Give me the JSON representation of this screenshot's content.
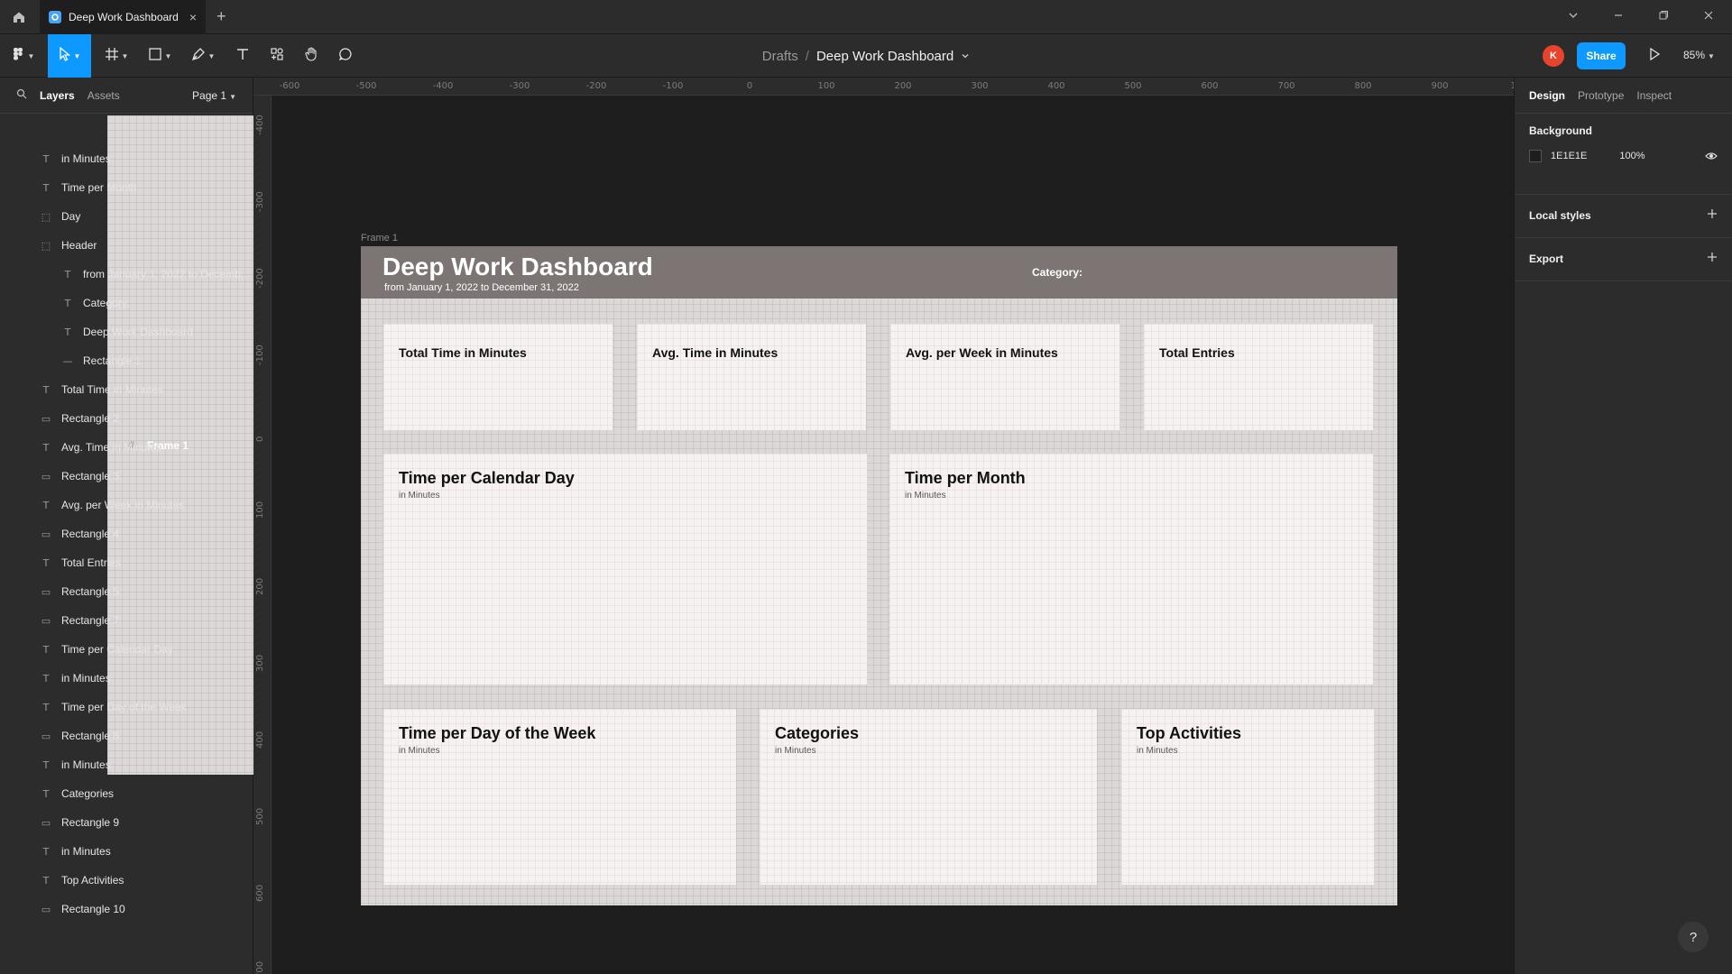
{
  "tab": {
    "title": "Deep Work Dashboard",
    "close": "×",
    "add": "+"
  },
  "breadcrumb": {
    "parent": "Drafts",
    "separator": "/",
    "file": "Deep Work Dashboard"
  },
  "toolbar": {
    "avatar_initial": "K",
    "share_label": "Share",
    "zoom": "85%"
  },
  "left_panel": {
    "tabs": [
      "Layers",
      "Assets"
    ],
    "page": "Page 1",
    "layers": [
      {
        "name": "Frame 1",
        "icon": "frame-icon",
        "indent": 0
      },
      {
        "name": "in Minutes",
        "icon": "text-icon",
        "indent": 1
      },
      {
        "name": "Time per Month",
        "icon": "text-icon",
        "indent": 1
      },
      {
        "name": "Day",
        "icon": "group-icon",
        "indent": 1
      },
      {
        "name": "Header",
        "icon": "group-icon",
        "indent": 1
      },
      {
        "name": "from January 1, 2022 to Decemb...",
        "icon": "text-icon",
        "indent": 2
      },
      {
        "name": "Category:",
        "icon": "text-icon",
        "indent": 2
      },
      {
        "name": "Deep Work Dashboard",
        "icon": "text-icon",
        "indent": 2
      },
      {
        "name": "Rectangle 1",
        "icon": "line-icon",
        "indent": 2
      },
      {
        "name": "Total Time in Minutes",
        "icon": "text-icon",
        "indent": 1
      },
      {
        "name": "Rectangle 2",
        "icon": "rectangle-icon",
        "indent": 1
      },
      {
        "name": "Avg. Time in Minutes",
        "icon": "text-icon",
        "indent": 1
      },
      {
        "name": "Rectangle 3",
        "icon": "rectangle-icon",
        "indent": 1
      },
      {
        "name": "Avg. per Week in Minutes",
        "icon": "text-icon",
        "indent": 1
      },
      {
        "name": "Rectangle 4",
        "icon": "rectangle-icon",
        "indent": 1
      },
      {
        "name": "Total Entries",
        "icon": "text-icon",
        "indent": 1
      },
      {
        "name": "Rectangle 5",
        "icon": "rectangle-icon",
        "indent": 1
      },
      {
        "name": "Rectangle 7",
        "icon": "rectangle-icon",
        "indent": 1
      },
      {
        "name": "Time per Calendar Day",
        "icon": "text-icon",
        "indent": 1
      },
      {
        "name": "in Minutes",
        "icon": "text-icon",
        "indent": 1
      },
      {
        "name": "Time per Day of the Week",
        "icon": "text-icon",
        "indent": 1
      },
      {
        "name": "Rectangle 8",
        "icon": "rectangle-icon",
        "indent": 1
      },
      {
        "name": "in Minutes",
        "icon": "text-icon",
        "indent": 1
      },
      {
        "name": "Categories",
        "icon": "text-icon",
        "indent": 1
      },
      {
        "name": "Rectangle 9",
        "icon": "rectangle-icon",
        "indent": 1
      },
      {
        "name": "in Minutes",
        "icon": "text-icon",
        "indent": 1
      },
      {
        "name": "Top Activities",
        "icon": "text-icon",
        "indent": 1
      },
      {
        "name": "Rectangle 10",
        "icon": "rectangle-icon",
        "indent": 1
      }
    ]
  },
  "rulers": {
    "top": [
      "-600",
      "-500",
      "-400",
      "-300",
      "-200",
      "-100",
      "0",
      "100",
      "200",
      "300",
      "400",
      "500",
      "600",
      "700",
      "800",
      "900",
      "10"
    ],
    "left": [
      "-400",
      "-300",
      "-200",
      "-100",
      "0",
      "100",
      "200",
      "300",
      "400",
      "500",
      "600",
      "700"
    ]
  },
  "canvas": {
    "frame_label": "Frame 1",
    "header": {
      "title": "Deep Work Dashboard",
      "subtitle": "from January 1, 2022 to December 31, 2022",
      "category": "Category:"
    },
    "kpi_cards": [
      {
        "title": "Total Time in Minutes"
      },
      {
        "title": "Avg. Time in Minutes"
      },
      {
        "title": "Avg. per Week in Minutes"
      },
      {
        "title": "Total Entries"
      }
    ],
    "chart_cards": [
      {
        "title": "Time per Calendar Day",
        "subtitle": "in Minutes"
      },
      {
        "title": "Time per Month",
        "subtitle": "in Minutes"
      },
      {
        "title": "Time per Day of the Week",
        "subtitle": "in Minutes"
      },
      {
        "title": "Categories",
        "subtitle": "in Minutes"
      },
      {
        "title": "Top Activities",
        "subtitle": "in Minutes"
      }
    ],
    "frame_background": "#DCD8D8",
    "header_background": "#7C7574"
  },
  "right_panel": {
    "tabs": [
      "Design",
      "Prototype",
      "Inspect"
    ],
    "background": {
      "heading": "Background",
      "hex": "1E1E1E",
      "opacity": "100%"
    },
    "local_styles": "Local styles",
    "export": "Export",
    "help": "?"
  },
  "colors": {
    "accent": "#0D99FF",
    "avatar": "#E8432C",
    "panel": "#2C2C2C",
    "canvas": "#1E1E1E"
  }
}
